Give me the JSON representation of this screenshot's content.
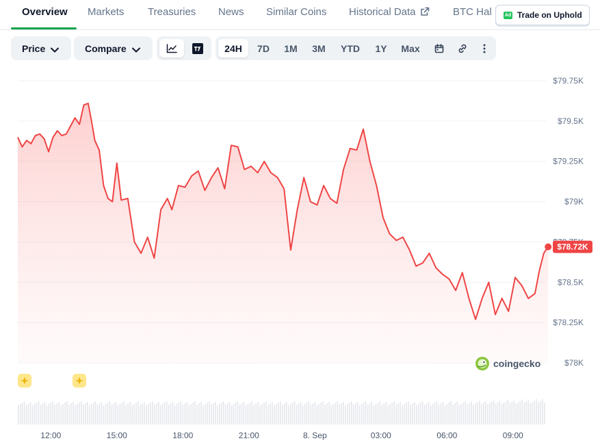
{
  "tabs": [
    {
      "label": "Overview",
      "active": true
    },
    {
      "label": "Markets"
    },
    {
      "label": "Treasuries"
    },
    {
      "label": "News"
    },
    {
      "label": "Similar Coins"
    },
    {
      "label": "Historical Data"
    },
    {
      "label": "BTC Hal"
    }
  ],
  "trade": {
    "badge": "Ad",
    "label": "Trade on Uphold"
  },
  "toolbar": {
    "price_label": "Price",
    "compare_label": "Compare",
    "chart_modes": [
      "line-chart-icon",
      "tradingview-icon"
    ],
    "ranges": [
      "24H",
      "7D",
      "1M",
      "3M",
      "YTD",
      "1Y",
      "Max"
    ],
    "active_range": "24H"
  },
  "watermark": "coingecko",
  "colors": {
    "line": "#ef4444",
    "fill": "#fecaca",
    "accent": "#16a34a",
    "tag": "#ef4444",
    "event": "#facc15"
  },
  "chart_data": {
    "type": "area",
    "ylim": [
      78000,
      79750
    ],
    "y_ticks": [
      "$79.75K",
      "$79.5K",
      "$79.25K",
      "$79K",
      "$78.75K",
      "$78.5K",
      "$78.25K",
      "$78K"
    ],
    "x_ticks": [
      "12:00",
      "15:00",
      "18:00",
      "21:00",
      "8. Sep",
      "03:00",
      "06:00",
      "09:00"
    ],
    "current_price_label": "$78.72K",
    "grid": true,
    "series": [
      {
        "x": [
          0,
          0.2,
          0.4,
          0.6,
          0.8,
          1,
          1.2,
          1.4,
          1.6,
          1.8,
          2,
          2.2,
          2.4,
          2.6,
          2.8,
          3,
          3.2,
          3.35,
          3.5,
          3.7,
          3.9,
          4.1,
          4.3,
          4.5,
          4.7,
          5,
          5.3,
          5.6,
          5.9,
          6.2,
          6.5,
          6.8,
          7,
          7.3,
          7.6,
          7.9,
          8.2,
          8.5,
          8.8,
          9.1,
          9.4,
          9.7,
          10,
          10.3,
          10.6,
          10.9,
          11.2,
          11.5,
          11.8,
          12.1,
          12.4,
          12.7,
          13,
          13.3,
          13.6,
          13.9,
          14.2,
          14.5,
          14.8,
          15.1,
          15.4,
          15.7,
          16,
          16.3,
          16.6,
          16.9,
          17.2,
          17.5,
          17.8,
          18.1,
          18.4,
          18.7,
          19,
          19.3,
          19.6,
          19.9,
          20.2,
          20.5,
          20.8,
          21.1,
          21.4,
          21.7,
          22,
          22.3,
          22.6,
          22.9,
          23.2,
          23.5,
          23.7,
          23.9,
          24.1
        ],
        "y": [
          79400,
          79340,
          79380,
          79360,
          79410,
          79420,
          79390,
          79310,
          79400,
          79440,
          79410,
          79420,
          79470,
          79520,
          79480,
          79600,
          79610,
          79500,
          79380,
          79320,
          79100,
          79020,
          79000,
          79240,
          79010,
          79020,
          78750,
          78680,
          78780,
          78650,
          78950,
          79020,
          78950,
          79100,
          79090,
          79160,
          79190,
          79070,
          79150,
          79210,
          79080,
          79350,
          79340,
          79200,
          79220,
          79180,
          79250,
          79180,
          79150,
          79080,
          78700,
          78950,
          79150,
          79000,
          78980,
          79100,
          79020,
          78990,
          79200,
          79330,
          79320,
          79450,
          79250,
          79100,
          78900,
          78800,
          78760,
          78780,
          78700,
          78600,
          78620,
          78680,
          78590,
          78550,
          78520,
          78450,
          78560,
          78400,
          78270,
          78400,
          78500,
          78300,
          78400,
          78320,
          78530,
          78480,
          78400,
          78430,
          78570,
          78680,
          78720
        ]
      }
    ]
  }
}
